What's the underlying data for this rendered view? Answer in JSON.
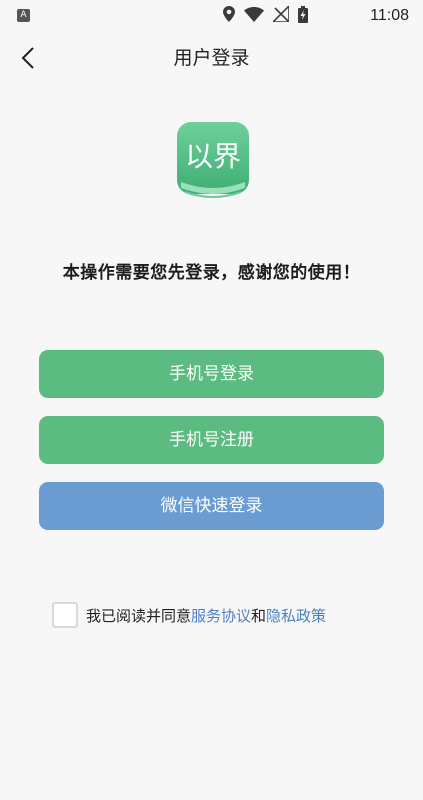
{
  "status_bar": {
    "left_icon_letter": "A",
    "time": "11:08",
    "icons": [
      "location-icon",
      "wifi-icon",
      "no-signal-icon",
      "battery-charging-icon"
    ]
  },
  "header": {
    "title": "用户登录",
    "back_icon": "chevron-left-icon"
  },
  "logo": {
    "text": "以界",
    "colors": {
      "top": "#6fd09a",
      "bottom": "#3fae73"
    }
  },
  "notice": "本操作需要您先登录，感谢您的使用！",
  "buttons": {
    "phone_login": "手机号登录",
    "phone_register": "手机号注册",
    "wechat_login": "微信快速登录"
  },
  "colors": {
    "green": "#5bbb80",
    "blue": "#6a9bd1",
    "link": "#4d7fc4"
  },
  "agreement": {
    "checked": false,
    "prefix": "我已阅读并同意",
    "service_link": "服务协议",
    "and": "和",
    "privacy_link": "隐私政策"
  }
}
